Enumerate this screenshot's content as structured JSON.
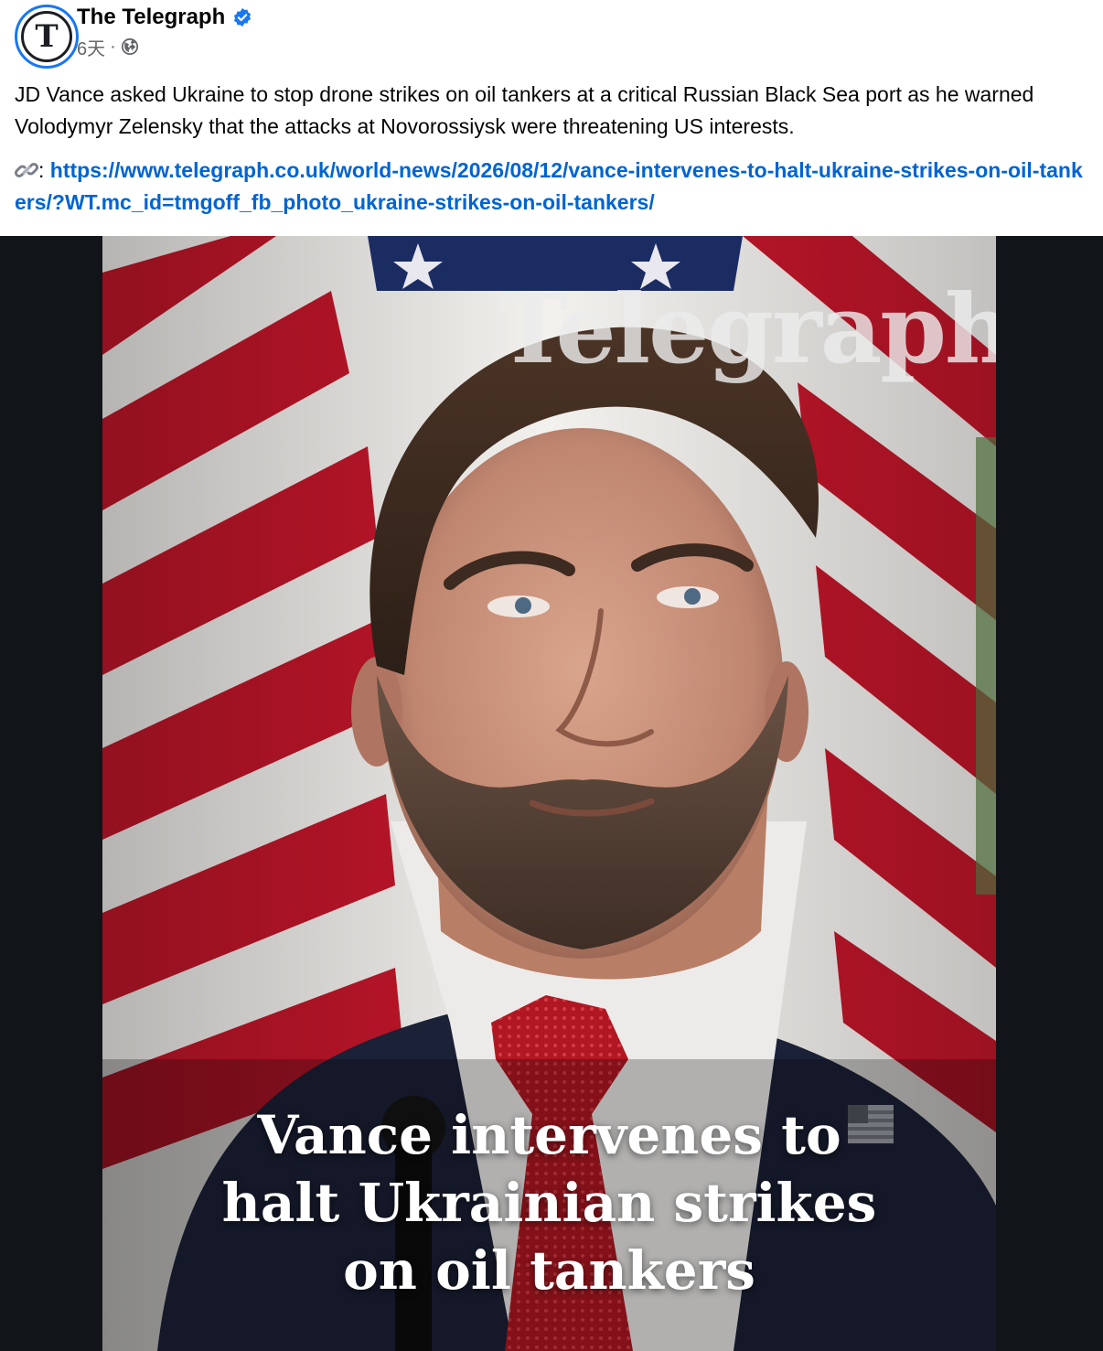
{
  "post": {
    "page_name": "The Telegraph",
    "avatar_logo": "T",
    "time": "6天",
    "separator": "·",
    "body": "JD Vance asked Ukraine to stop drone strikes on oil tankers at a critical Russian Black Sea port as he warned Volodymyr Zelensky that the attacks at Novorossiysk were threatening US interests.",
    "link_prefix": ":",
    "link_url": "https://www.telegraph.co.uk/world-news/2026/08/12/vance-intervenes-to-halt-ukraine-strikes-on-oil-tankers/?WT.mc_id=tmgoff_fb_photo_ukraine-strikes-on-oil-tankers/"
  },
  "media": {
    "watermark": "Telegraph",
    "caption_lines": [
      "Vance intervenes to",
      "halt Ukrainian strikes",
      "on oil tankers"
    ]
  },
  "icons": {
    "verified": "verified-badge-icon",
    "audience": "globe-icon",
    "link": "link-icon"
  },
  "colors": {
    "verified_blue": "#1877f2",
    "link_blue": "#0064d1",
    "secondary_text": "#65676b",
    "media_background": "#111418"
  }
}
